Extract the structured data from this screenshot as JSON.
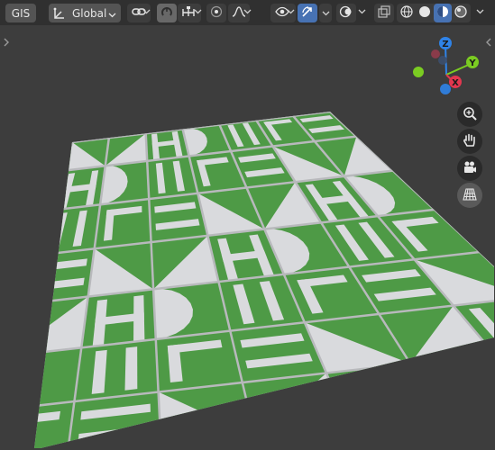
{
  "header": {
    "gis_label": "GIS",
    "orientation_label": "Global"
  },
  "gizmo": {
    "z_label": "Z",
    "y_label": "Y",
    "x_label": "X"
  },
  "icons": {
    "orientation": "transform-orientation-icon",
    "snap": "link-snap-icon",
    "proportional": "proportional-editing-icon",
    "visibility": "object-visibility-icon",
    "gizmos": "gizmo-toggle-icon",
    "overlays": "overlays-icon",
    "xray": "xray-toggle-icon",
    "shading_wire": "wireframe-shading-icon",
    "shading_solid": "solid-shading-icon",
    "shading_material": "material-preview-icon",
    "shading_rendered": "rendered-shading-icon",
    "zoom": "zoom-icon",
    "pan": "hand-pan-icon",
    "camera": "camera-view-icon",
    "perspective": "perspective-grid-icon"
  },
  "colors": {
    "tile_green": "#4e9a46",
    "tile_white": "#d9dadd",
    "active_button": "#4772b3",
    "axis_x": "#e3374f",
    "axis_y": "#7bcc22",
    "axis_z": "#2f83e8"
  }
}
